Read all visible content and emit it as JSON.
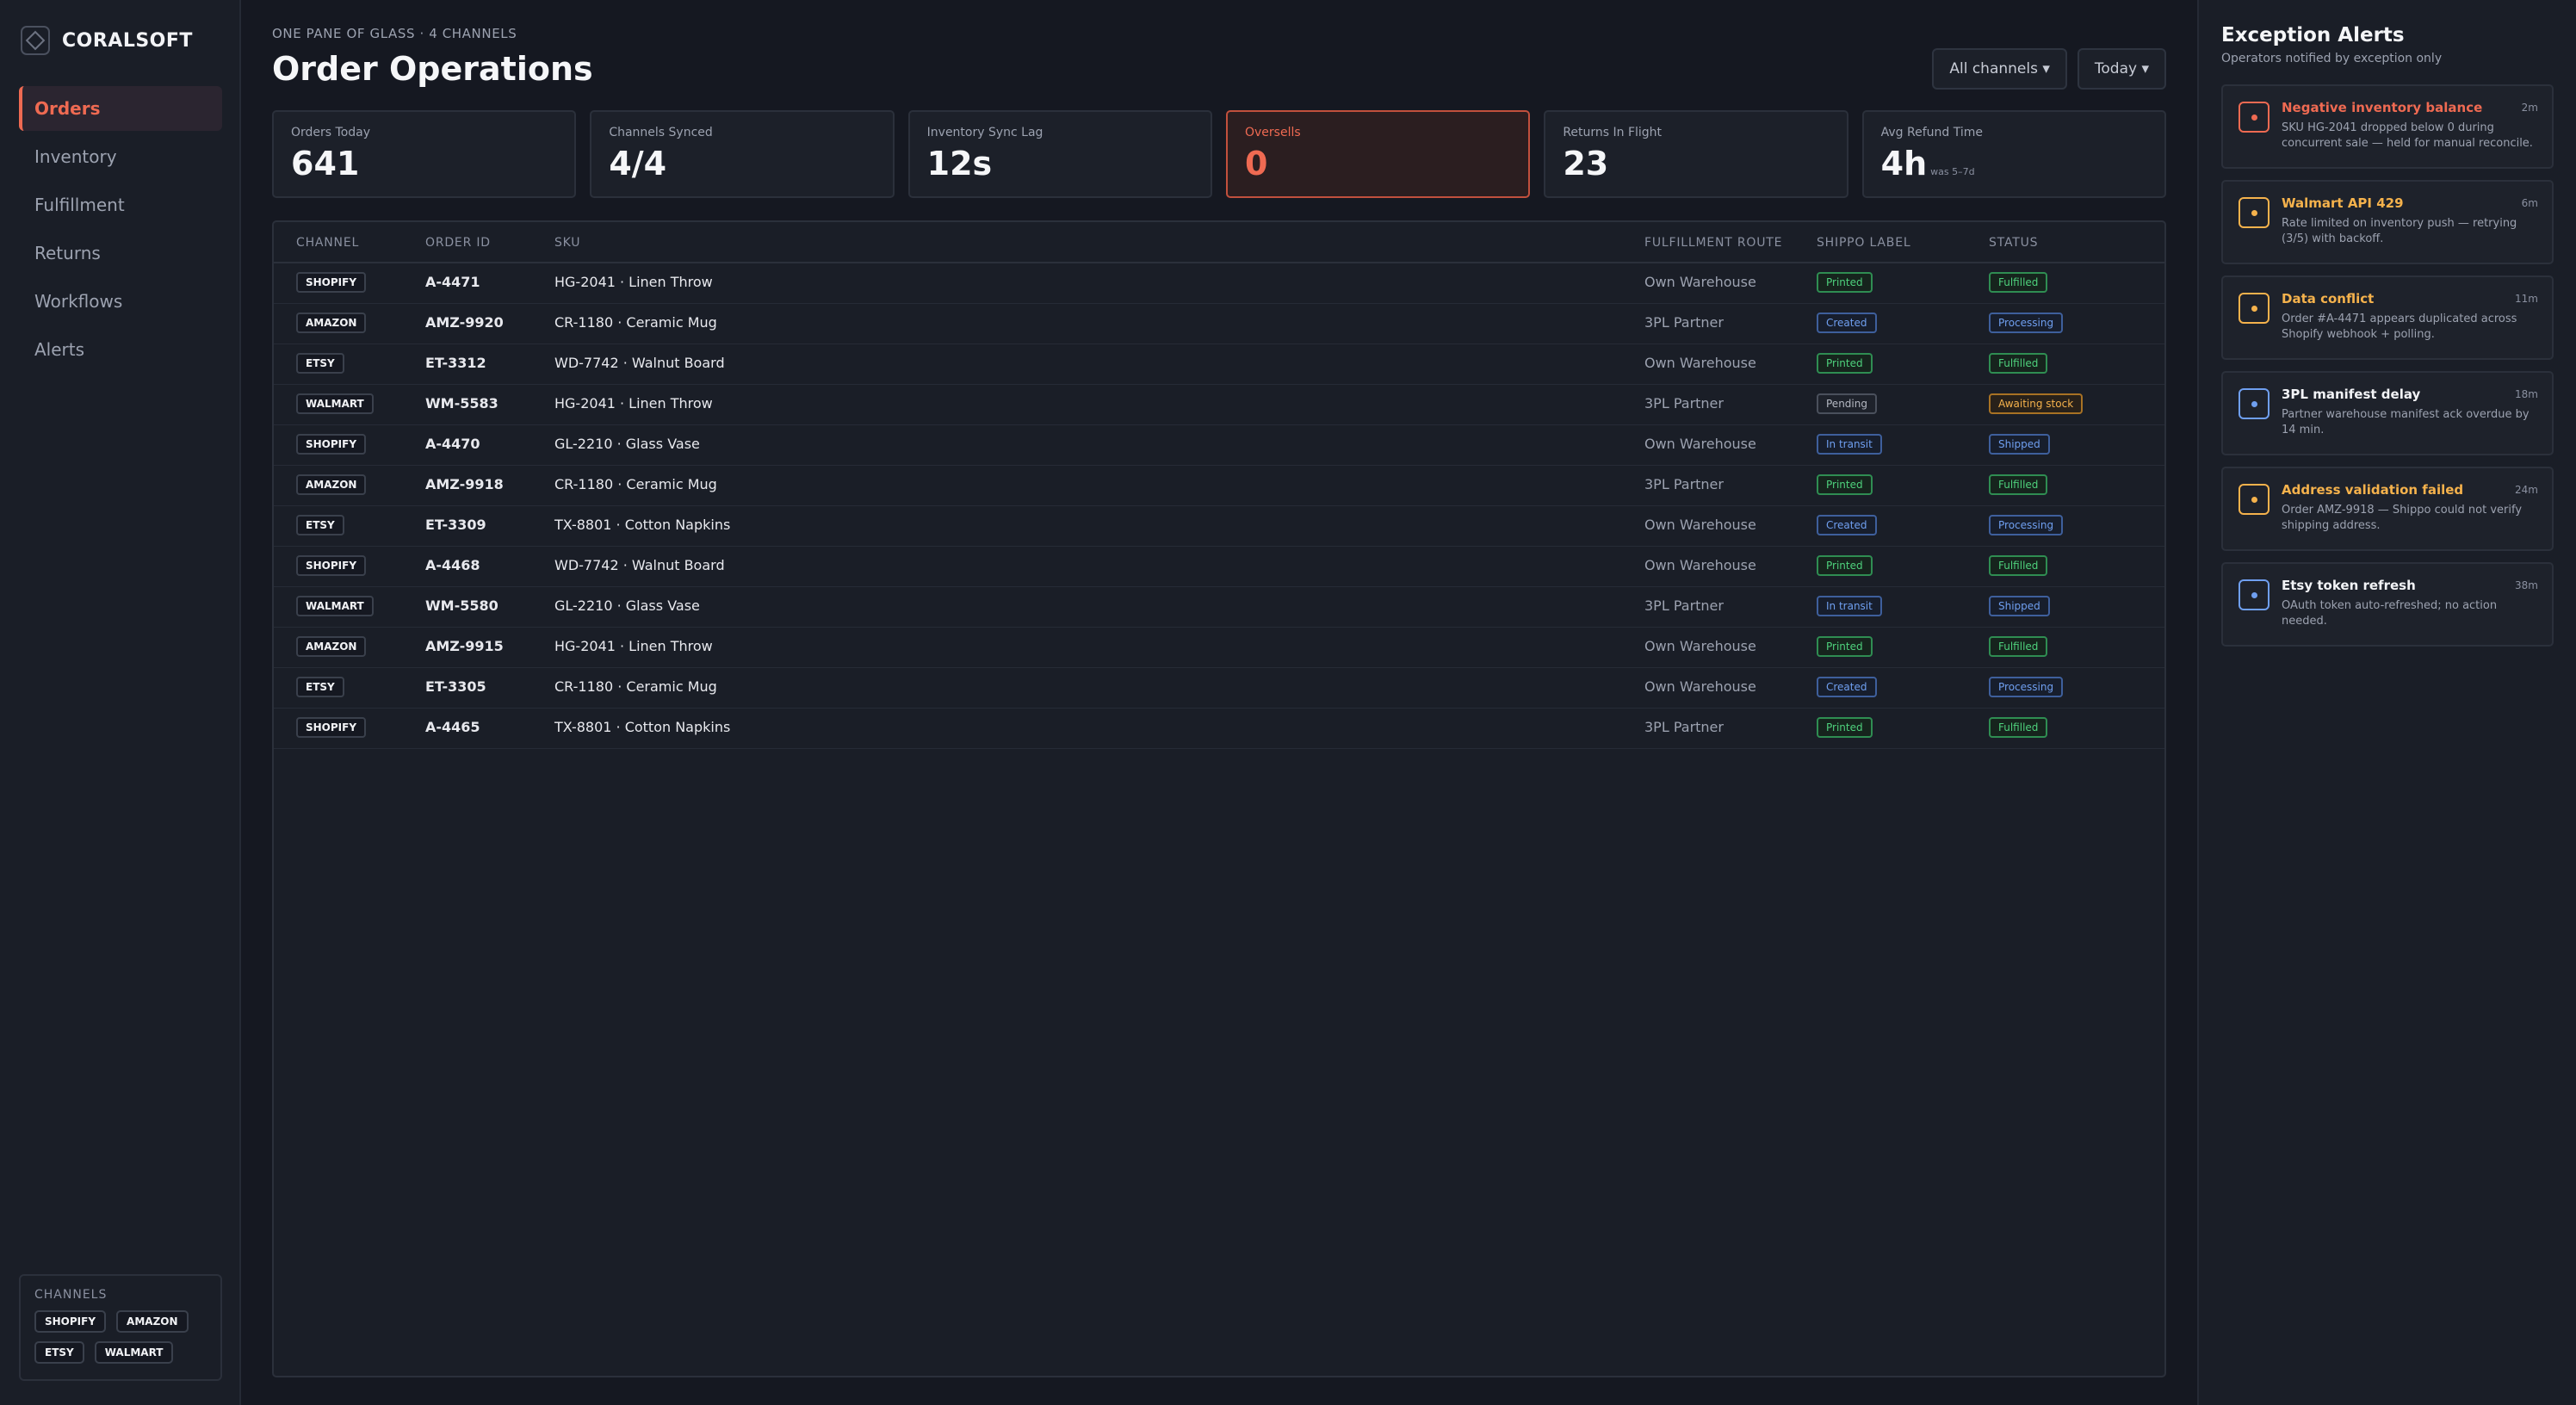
{
  "brand": {
    "name": "CORALSOFT",
    "logo_icon": "diamond-logo-icon"
  },
  "nav": [
    {
      "label": "Orders",
      "active": true
    },
    {
      "label": "Inventory",
      "active": false
    },
    {
      "label": "Fulfillment",
      "active": false
    },
    {
      "label": "Returns",
      "active": false
    },
    {
      "label": "Workflows",
      "active": false
    },
    {
      "label": "Alerts",
      "active": false
    }
  ],
  "channels_box": {
    "title": "CHANNELS",
    "items": [
      "SHOPIFY",
      "AMAZON",
      "ETSY",
      "WALMART"
    ]
  },
  "header": {
    "eyebrow": "ONE PANE OF GLASS · 4 CHANNELS",
    "title": "Order Operations"
  },
  "filters": {
    "channels": "All channels ▾",
    "date": "Today ▾"
  },
  "stats": [
    {
      "label": "Orders Today",
      "value": "641",
      "sub": ""
    },
    {
      "label": "Channels Synced",
      "value": "4/4",
      "sub": ""
    },
    {
      "label": "Inventory Sync Lag",
      "value": "12s",
      "sub": ""
    },
    {
      "label": "Oversells",
      "value": "0",
      "sub": "",
      "highlight": "#ef6a52"
    },
    {
      "label": "Returns In Flight",
      "value": "23",
      "sub": ""
    },
    {
      "label": "Avg Refund Time",
      "value": "4h",
      "sub": "was 5–7d"
    }
  ],
  "table": {
    "headers": {
      "channel": "CHANNEL",
      "order_id": "ORDER ID",
      "sku": "SKU",
      "route": "FULFILLMENT ROUTE",
      "label": "SHIPPO LABEL",
      "status": "STATUS"
    },
    "rows": [
      {
        "channel": "SHOPIFY",
        "order_id": "A-4471",
        "sku": "HG-2041 · Linen Throw",
        "route": "Own Warehouse",
        "label": "Printed",
        "status": "Fulfilled"
      },
      {
        "channel": "AMAZON",
        "order_id": "AMZ-9920",
        "sku": "CR-1180 · Ceramic Mug",
        "route": "3PL Partner",
        "label": "Created",
        "status": "Processing"
      },
      {
        "channel": "ETSY",
        "order_id": "ET-3312",
        "sku": "WD-7742 · Walnut Board",
        "route": "Own Warehouse",
        "label": "Printed",
        "status": "Fulfilled"
      },
      {
        "channel": "WALMART",
        "order_id": "WM-5583",
        "sku": "HG-2041 · Linen Throw",
        "route": "3PL Partner",
        "label": "Pending",
        "status": "Awaiting stock"
      },
      {
        "channel": "SHOPIFY",
        "order_id": "A-4470",
        "sku": "GL-2210 · Glass Vase",
        "route": "Own Warehouse",
        "label": "In transit",
        "status": "Shipped"
      },
      {
        "channel": "AMAZON",
        "order_id": "AMZ-9918",
        "sku": "CR-1180 · Ceramic Mug",
        "route": "3PL Partner",
        "label": "Printed",
        "status": "Fulfilled"
      },
      {
        "channel": "ETSY",
        "order_id": "ET-3309",
        "sku": "TX-8801 · Cotton Napkins",
        "route": "Own Warehouse",
        "label": "Created",
        "status": "Processing"
      },
      {
        "channel": "SHOPIFY",
        "order_id": "A-4468",
        "sku": "WD-7742 · Walnut Board",
        "route": "Own Warehouse",
        "label": "Printed",
        "status": "Fulfilled"
      },
      {
        "channel": "WALMART",
        "order_id": "WM-5580",
        "sku": "GL-2210 · Glass Vase",
        "route": "3PL Partner",
        "label": "In transit",
        "status": "Shipped"
      },
      {
        "channel": "AMAZON",
        "order_id": "AMZ-9915",
        "sku": "HG-2041 · Linen Throw",
        "route": "Own Warehouse",
        "label": "Printed",
        "status": "Fulfilled"
      },
      {
        "channel": "ETSY",
        "order_id": "ET-3305",
        "sku": "CR-1180 · Ceramic Mug",
        "route": "Own Warehouse",
        "label": "Created",
        "status": "Processing"
      },
      {
        "channel": "SHOPIFY",
        "order_id": "A-4465",
        "sku": "TX-8801 · Cotton Napkins",
        "route": "3PL Partner",
        "label": "Printed",
        "status": "Fulfilled"
      }
    ]
  },
  "alerts": {
    "title": "Exception Alerts",
    "subtitle": "Operators notified by exception only",
    "items": [
      {
        "title": "Negative inventory balance",
        "time": "2m",
        "body": "SKU HG-2041 dropped below 0 during concurrent sale — held for manual reconcile.",
        "severity": "red"
      },
      {
        "title": "Walmart API 429",
        "time": "6m",
        "body": "Rate limited on inventory push — retrying (3/5) with backoff.",
        "severity": "amber"
      },
      {
        "title": "Data conflict",
        "time": "11m",
        "body": "Order #A-4471 appears duplicated across Shopify webhook + polling.",
        "severity": "amber"
      },
      {
        "title": "3PL manifest delay",
        "time": "18m",
        "body": "Partner warehouse manifest ack overdue by 14 min.",
        "severity": "blue"
      },
      {
        "title": "Address validation failed",
        "time": "24m",
        "body": "Order AMZ-9918 — Shippo could not verify shipping address.",
        "severity": "amber"
      },
      {
        "title": "Etsy token refresh",
        "time": "38m",
        "body": "OAuth token auto-refreshed; no action needed.",
        "severity": "blue"
      }
    ]
  },
  "colors": {
    "accent": "#ef6a52",
    "green": "#4ed17c",
    "blue": "#6f9ff0",
    "amber": "#f5b24c",
    "background": "#151821"
  }
}
